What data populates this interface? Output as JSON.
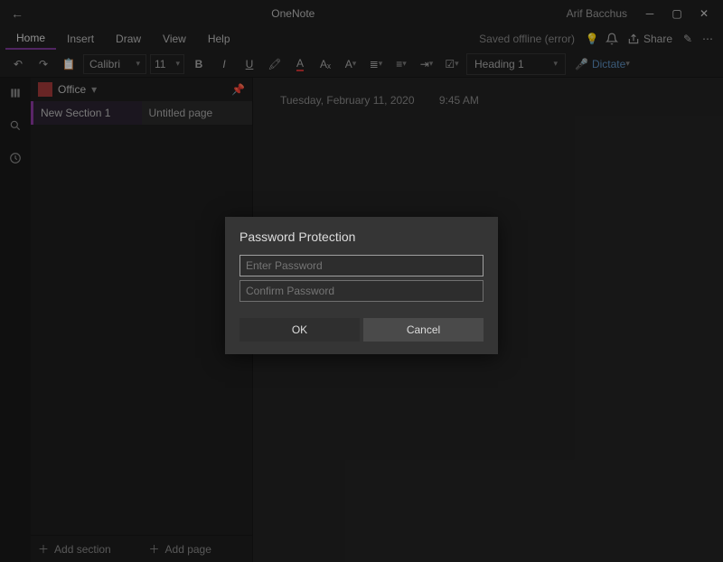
{
  "window": {
    "title": "OneNote",
    "user": "Arif Bacchus"
  },
  "menu": {
    "items": [
      "Home",
      "Insert",
      "Draw",
      "View",
      "Help"
    ],
    "active": "Home",
    "status": "Saved offline (error)",
    "share_label": "Share"
  },
  "ribbon": {
    "font_name": "Calibri",
    "font_size": "11",
    "style_label": "Heading 1",
    "dictate_label": "Dictate"
  },
  "notebook": {
    "name": "Office",
    "section": "New Section 1",
    "page": "Untitled page",
    "add_section": "Add section",
    "add_page": "Add page"
  },
  "page": {
    "date": "Tuesday, February 11, 2020",
    "time": "9:45 AM"
  },
  "dialog": {
    "title": "Password Protection",
    "placeholder_password": "Enter Password",
    "placeholder_confirm": "Confirm Password",
    "ok": "OK",
    "cancel": "Cancel"
  }
}
